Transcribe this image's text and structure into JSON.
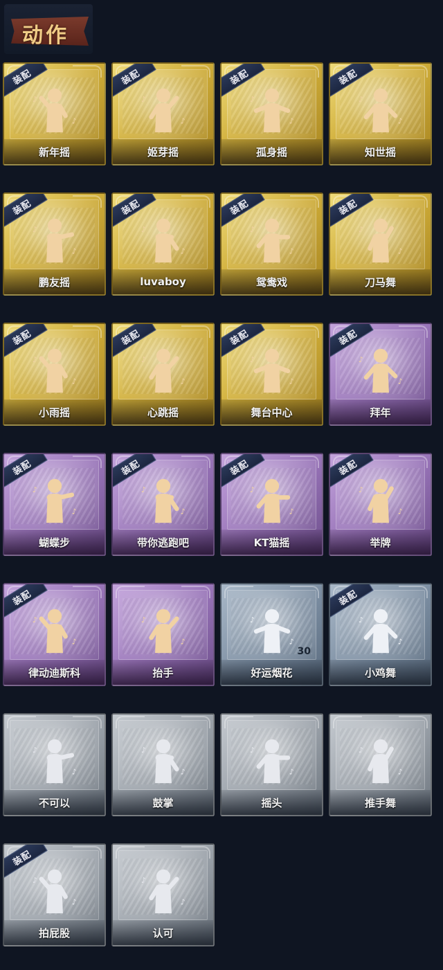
{
  "header": {
    "title": "动作"
  },
  "badge_label": "装配",
  "items": [
    {
      "label": "新年摇",
      "tier": "gold",
      "equipped": true
    },
    {
      "label": "姬芽摇",
      "tier": "gold",
      "equipped": true
    },
    {
      "label": "孤身摇",
      "tier": "gold",
      "equipped": true
    },
    {
      "label": "知世摇",
      "tier": "gold",
      "equipped": true
    },
    {
      "label": "鹏友摇",
      "tier": "gold",
      "equipped": true
    },
    {
      "label": "luvaboy",
      "tier": "gold",
      "equipped": true
    },
    {
      "label": "鸳鸯戏",
      "tier": "gold",
      "equipped": true
    },
    {
      "label": "刀马舞",
      "tier": "gold",
      "equipped": true
    },
    {
      "label": "小雨摇",
      "tier": "gold",
      "equipped": true
    },
    {
      "label": "心跳摇",
      "tier": "gold",
      "equipped": true
    },
    {
      "label": "舞台中心",
      "tier": "gold",
      "equipped": true
    },
    {
      "label": "拜年",
      "tier": "purple",
      "equipped": true
    },
    {
      "label": "蝴蝶步",
      "tier": "purple",
      "equipped": true
    },
    {
      "label": "带你逃跑吧",
      "tier": "purple",
      "equipped": true
    },
    {
      "label": "KT猫摇",
      "tier": "purple",
      "equipped": true
    },
    {
      "label": "举牌",
      "tier": "purple",
      "equipped": true
    },
    {
      "label": "律动迪斯科",
      "tier": "purple",
      "equipped": true
    },
    {
      "label": "抬手",
      "tier": "purple",
      "equipped": false
    },
    {
      "label": "好运烟花",
      "tier": "blue",
      "equipped": false,
      "count": "30"
    },
    {
      "label": "小鸡舞",
      "tier": "blue",
      "equipped": true
    },
    {
      "label": "不可以",
      "tier": "grey",
      "equipped": false
    },
    {
      "label": "鼓掌",
      "tier": "grey",
      "equipped": false
    },
    {
      "label": "摇头",
      "tier": "grey",
      "equipped": false
    },
    {
      "label": "推手舞",
      "tier": "grey",
      "equipped": false
    },
    {
      "label": "拍屁股",
      "tier": "grey",
      "equipped": true
    },
    {
      "label": "认可",
      "tier": "grey",
      "equipped": false
    }
  ],
  "colors": {
    "background": "#0f1522",
    "gold": "#d0ae3a",
    "purple": "#9874b8",
    "blue": "#7a8ca0",
    "grey": "#979ea6",
    "badge": "#1c2640"
  }
}
